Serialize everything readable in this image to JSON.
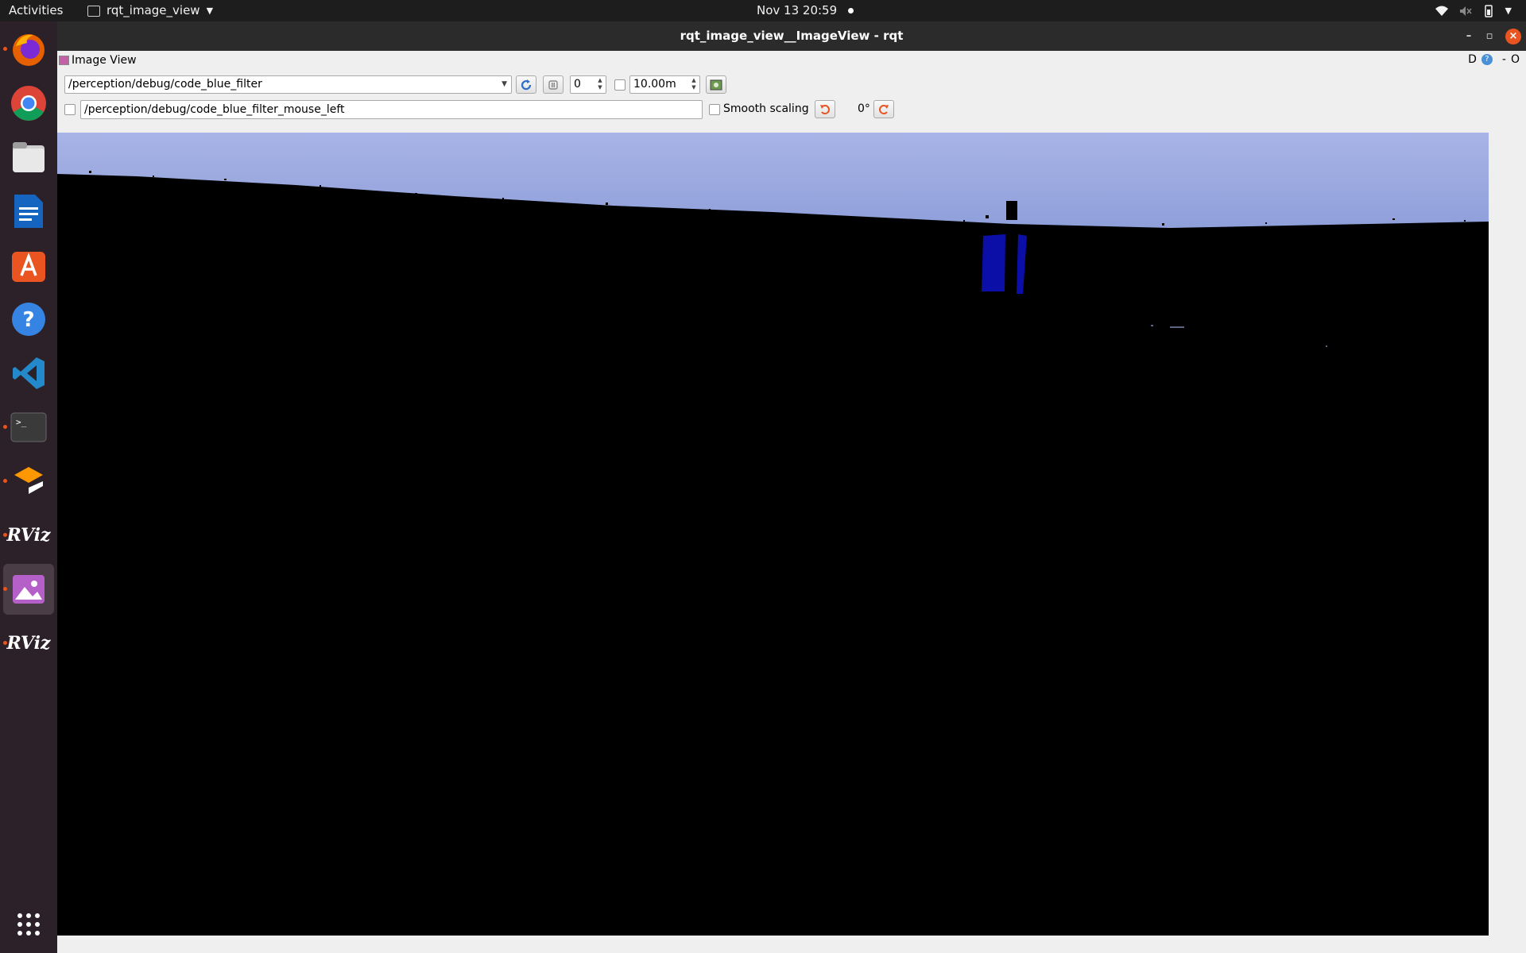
{
  "topbar": {
    "activities": "Activities",
    "app_name": "rqt_image_view",
    "clock": "Nov 13  20:59"
  },
  "dock": {
    "apps": [
      "firefox",
      "chrome",
      "files",
      "libreoffice-writer",
      "app-center",
      "help",
      "vscode",
      "terminal",
      "sublime-merge",
      "rviz",
      "image-viewer",
      "rviz"
    ],
    "rviz_label": "RViz",
    "running_color": "#e95420"
  },
  "window": {
    "title": "rqt_image_view__ImageView - rqt",
    "plugin_title": "Image View",
    "plugin_tools": {
      "d_label": "D",
      "help": "?",
      "dash": "-",
      "o_label": "O"
    }
  },
  "toolbar": {
    "topic": "/perception/debug/code_blue_filter",
    "spin_value": "0",
    "max_range": "10.00m",
    "mouse_topic": "/perception/debug/code_blue_filter_mouse_left",
    "smooth_scaling_label": "Smooth scaling",
    "rotation": "0°"
  },
  "colors": {
    "sky_top": "#a7b4e8",
    "sky_bottom": "#8fa0da",
    "blue_object": "#0b0fa8",
    "accent": "#e95420"
  }
}
